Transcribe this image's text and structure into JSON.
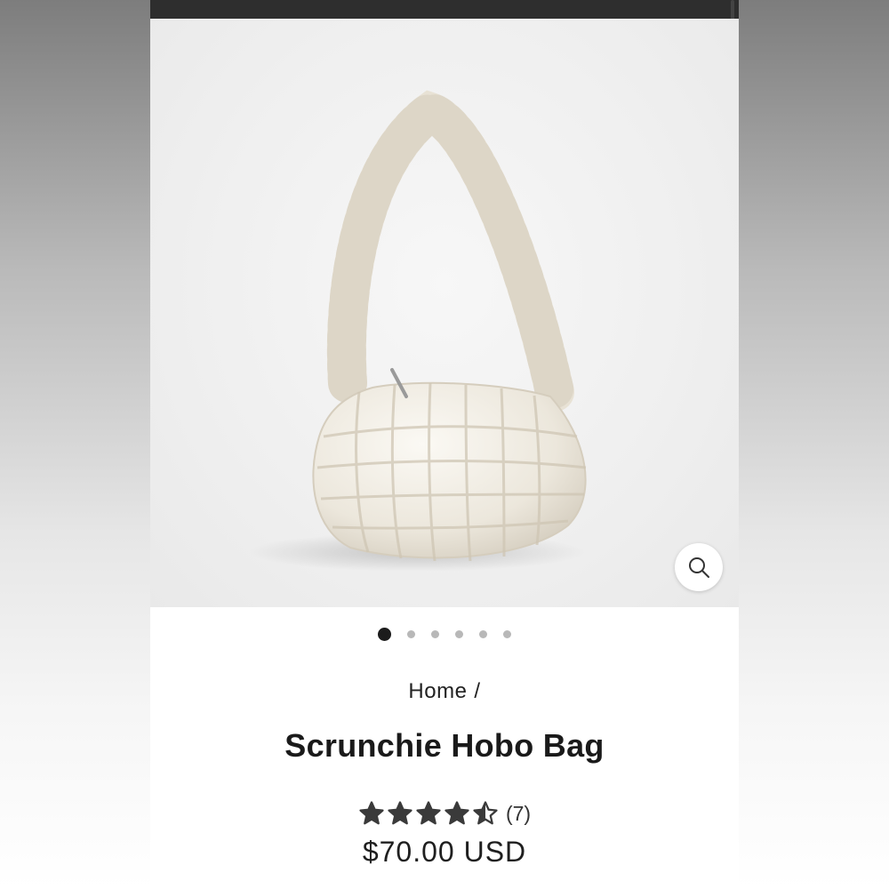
{
  "product": {
    "image_alt": "Scrunchie Hobo Bag product photo",
    "gallery": {
      "total_images": 6,
      "active_index": 0
    },
    "breadcrumb": {
      "home_label": "Home",
      "separator": "/"
    },
    "title": "Scrunchie Hobo Bag",
    "rating": {
      "value": 4.5,
      "max": 5,
      "review_count_label": "(7)"
    },
    "price": "$70.00 USD"
  },
  "icons": {
    "zoom": "search-icon",
    "star": "star-icon"
  },
  "colors": {
    "top_bar": "#2e2e2e",
    "text": "#1a1a1a",
    "dot_active": "#1c1c1c",
    "dot_inactive": "#b8b8b8",
    "star": "#3a3a3a"
  }
}
